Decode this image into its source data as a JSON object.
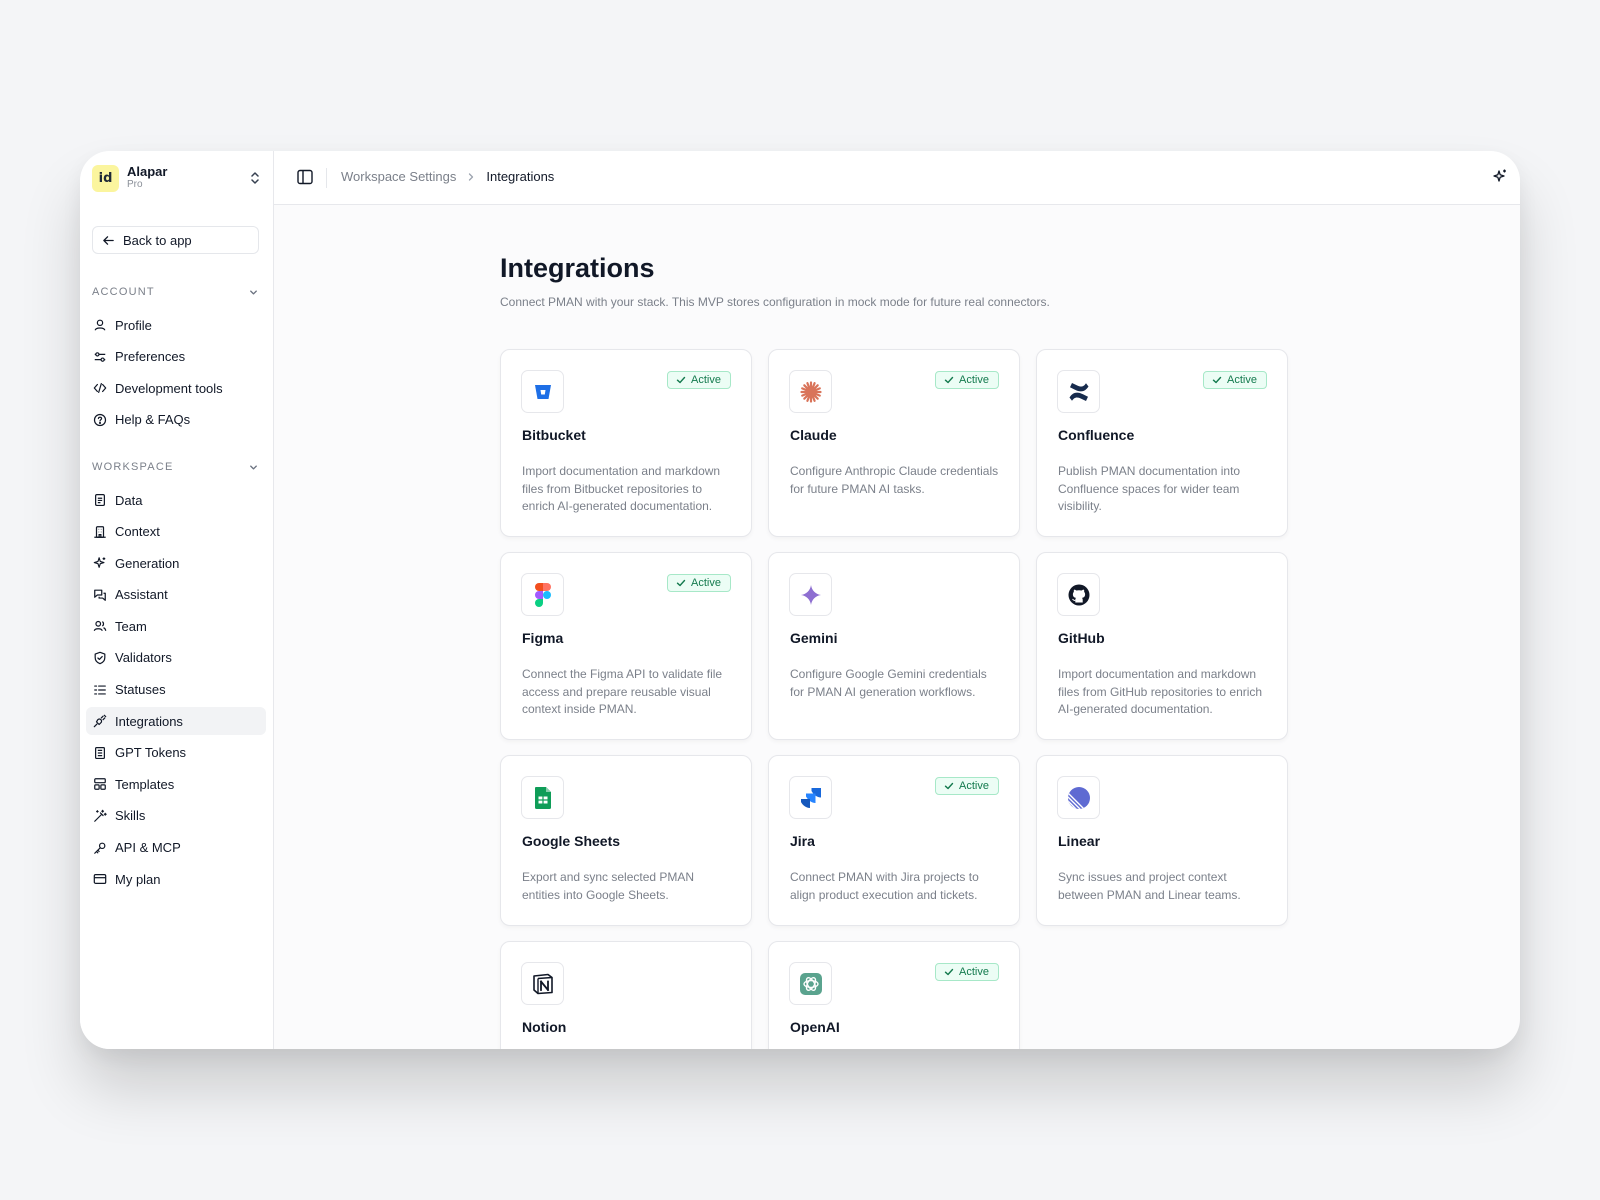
{
  "workspace": {
    "logo": "id",
    "name": "Alapar",
    "plan": "Pro"
  },
  "sidebar": {
    "back_label": "Back to app",
    "sections": [
      {
        "title": "ACCOUNT",
        "items": [
          {
            "label": "Profile",
            "icon": "user-icon"
          },
          {
            "label": "Preferences",
            "icon": "sliders-icon"
          },
          {
            "label": "Development tools",
            "icon": "code-icon"
          },
          {
            "label": "Help & FAQs",
            "icon": "help-circle-icon"
          }
        ]
      },
      {
        "title": "WORKSPACE",
        "items": [
          {
            "label": "Data",
            "icon": "file-icon"
          },
          {
            "label": "Context",
            "icon": "building-icon"
          },
          {
            "label": "Generation",
            "icon": "sparkle-icon"
          },
          {
            "label": "Assistant",
            "icon": "chat-icon"
          },
          {
            "label": "Team",
            "icon": "users-icon"
          },
          {
            "label": "Validators",
            "icon": "shield-check-icon"
          },
          {
            "label": "Statuses",
            "icon": "list-icon"
          },
          {
            "label": "Integrations",
            "icon": "plug-icon",
            "active": true
          },
          {
            "label": "GPT Tokens",
            "icon": "receipt-icon"
          },
          {
            "label": "Templates",
            "icon": "layout-icon"
          },
          {
            "label": "Skills",
            "icon": "wand-icon"
          },
          {
            "label": "API & MCP",
            "icon": "key-icon"
          },
          {
            "label": "My plan",
            "icon": "credit-card-icon"
          }
        ]
      }
    ]
  },
  "header": {
    "breadcrumb": {
      "parent": "Workspace Settings",
      "current": "Integrations"
    }
  },
  "page": {
    "title": "Integrations",
    "subtitle": "Connect PMAN with your stack. This MVP stores configuration in mock mode for future real connectors."
  },
  "integrations": [
    {
      "name": "Bitbucket",
      "icon": "bitbucket-icon",
      "active": true,
      "status": "Active",
      "description": "Import documentation and markdown files from Bitbucket repositories to enrich AI-generated documentation."
    },
    {
      "name": "Claude",
      "icon": "claude-icon",
      "active": true,
      "status": "Active",
      "description": "Configure Anthropic Claude credentials for future PMAN AI tasks."
    },
    {
      "name": "Confluence",
      "icon": "confluence-icon",
      "active": true,
      "status": "Active",
      "description": "Publish PMAN documentation into Confluence spaces for wider team visibility."
    },
    {
      "name": "Figma",
      "icon": "figma-icon",
      "active": true,
      "status": "Active",
      "description": "Connect the Figma API to validate file access and prepare reusable visual context inside PMAN."
    },
    {
      "name": "Gemini",
      "icon": "gemini-icon",
      "active": false,
      "status": "",
      "description": "Configure Google Gemini credentials for PMAN AI generation workflows."
    },
    {
      "name": "GitHub",
      "icon": "github-icon",
      "active": false,
      "status": "",
      "description": "Import documentation and markdown files from GitHub repositories to enrich AI-generated documentation."
    },
    {
      "name": "Google Sheets",
      "icon": "google-sheets-icon",
      "active": false,
      "status": "",
      "description": "Export and sync selected PMAN entities into Google Sheets."
    },
    {
      "name": "Jira",
      "icon": "jira-icon",
      "active": true,
      "status": "Active",
      "description": "Connect PMAN with Jira projects to align product execution and tickets."
    },
    {
      "name": "Linear",
      "icon": "linear-icon",
      "active": false,
      "status": "",
      "description": "Sync issues and project context between PMAN and Linear teams."
    },
    {
      "name": "Notion",
      "icon": "notion-icon",
      "active": false,
      "status": "",
      "description": ""
    },
    {
      "name": "OpenAI",
      "icon": "openai-icon",
      "active": true,
      "status": "Active",
      "description": ""
    }
  ],
  "colors": {
    "accent_active_bg": "#ecfdf5",
    "accent_active_text": "#147a4e",
    "workspace_logo_bg": "#fbf59e"
  }
}
